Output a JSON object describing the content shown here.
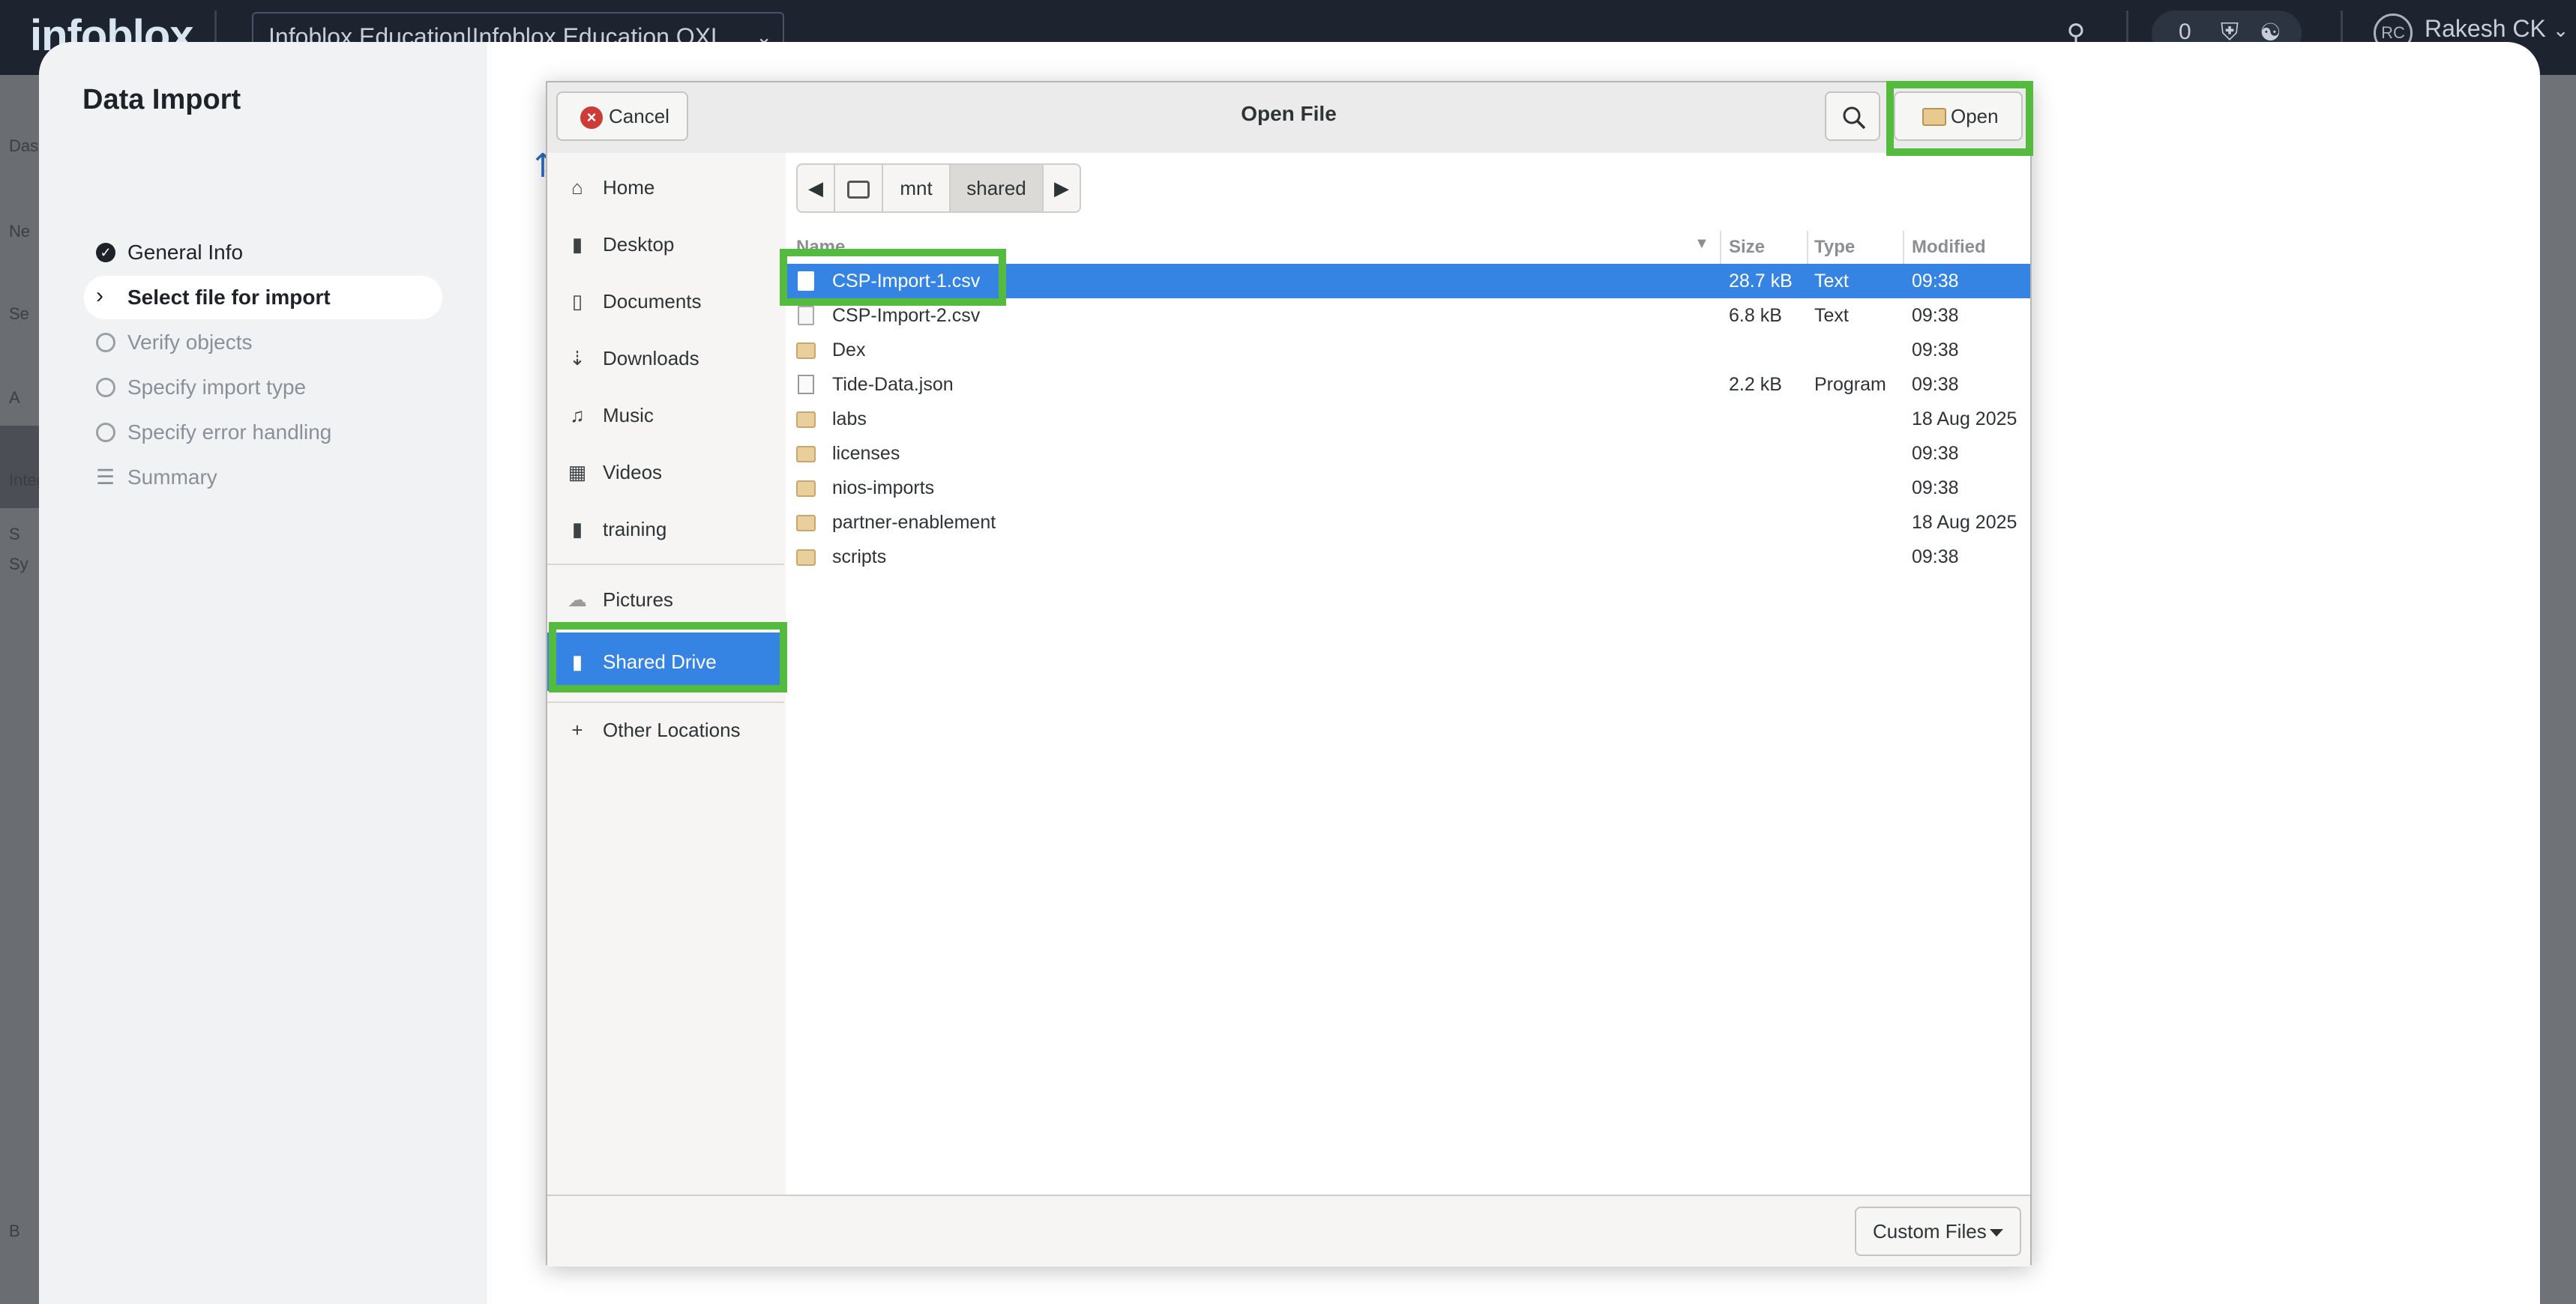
{
  "topbar": {
    "logo": "infoblox",
    "org_selector": "Infoblox Education|Infoblox Education OXL",
    "notifications_count": "0",
    "user_initials": "RC",
    "user_name": "Rakesh CK"
  },
  "background_nav": {
    "labels": [
      "Das",
      "Ne",
      "Se",
      "A",
      "Integ",
      "S",
      "Sy",
      "B"
    ]
  },
  "wizard": {
    "title": "Data Import",
    "steps": [
      {
        "label": "General Info",
        "state": "done"
      },
      {
        "label": "Select file for import",
        "state": "current"
      },
      {
        "label": "Verify objects",
        "state": "todo"
      },
      {
        "label": "Specify import type",
        "state": "todo"
      },
      {
        "label": "Specify error handling",
        "state": "todo"
      },
      {
        "label": "Summary",
        "state": "todo"
      }
    ]
  },
  "dialog": {
    "title": "Open File",
    "cancel_label": "Cancel",
    "open_label": "Open",
    "filter_label": "Custom Files",
    "places": [
      {
        "label": "Home",
        "icon": "home-icon"
      },
      {
        "label": "Desktop",
        "icon": "folder-icon"
      },
      {
        "label": "Documents",
        "icon": "document-icon"
      },
      {
        "label": "Downloads",
        "icon": "download-icon"
      },
      {
        "label": "Music",
        "icon": "music-icon"
      },
      {
        "label": "Videos",
        "icon": "video-icon"
      },
      {
        "label": "training",
        "icon": "folder-icon"
      },
      {
        "label": "Pictures",
        "icon": "pictures-icon"
      },
      {
        "label": "Shared Drive",
        "icon": "folder-icon",
        "active": true
      },
      {
        "label": "Other Locations",
        "icon": "plus-icon"
      }
    ],
    "path": [
      "mnt",
      "shared"
    ],
    "columns": {
      "name": "Name",
      "size": "Size",
      "type": "Type",
      "modified": "Modified"
    },
    "files": [
      {
        "name": "CSP-Import-1.csv",
        "size": "28.7 kB",
        "type": "Text",
        "modified": "09:38",
        "kind": "file",
        "selected": true
      },
      {
        "name": "CSP-Import-2.csv",
        "size": "6.8 kB",
        "type": "Text",
        "modified": "09:38",
        "kind": "file"
      },
      {
        "name": "Dex",
        "size": "",
        "type": "",
        "modified": "09:38",
        "kind": "folder"
      },
      {
        "name": "Tide-Data.json",
        "size": "2.2 kB",
        "type": "Program",
        "modified": "09:38",
        "kind": "json"
      },
      {
        "name": "labs",
        "size": "",
        "type": "",
        "modified": "18 Aug 2025",
        "kind": "folder"
      },
      {
        "name": "licenses",
        "size": "",
        "type": "",
        "modified": "09:38",
        "kind": "folder"
      },
      {
        "name": "nios-imports",
        "size": "",
        "type": "",
        "modified": "09:38",
        "kind": "folder"
      },
      {
        "name": "partner-enablement",
        "size": "",
        "type": "",
        "modified": "18 Aug 2025",
        "kind": "folder"
      },
      {
        "name": "scripts",
        "size": "",
        "type": "",
        "modified": "09:38",
        "kind": "folder"
      }
    ]
  },
  "colors": {
    "highlight": "#55bb3e",
    "selection": "#3584e4",
    "topbar": "#1d2430"
  }
}
